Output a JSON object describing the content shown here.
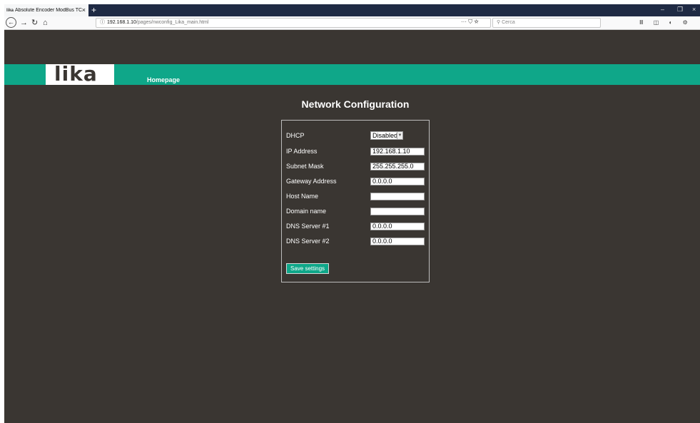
{
  "browser": {
    "tab": {
      "favicon": "lika",
      "title": "Absolute Encoder ModBus TCP",
      "close": "×"
    },
    "new_tab": "+",
    "window_controls": {
      "minimize": "–",
      "restore": "❐",
      "close": "×"
    },
    "url": {
      "host": "192.168.1.10",
      "path": "/pages/nwconfig_Lika_main.html"
    },
    "url_actions": "··· ⛉ ☆",
    "search_placeholder": "Cerca",
    "toolbar_icons": "Ⅲ ◫ ◐ ⚙ ≡"
  },
  "header": {
    "logo": "lika",
    "home_link": "Homepage"
  },
  "page_title": "Network Configuration",
  "form": {
    "dhcp": {
      "label": "DHCP",
      "value": "Disabled"
    },
    "ip_address": {
      "label": "IP Address",
      "value": "192.168.1.10"
    },
    "subnet_mask": {
      "label": "Subnet Mask",
      "value": "255.255.255.0"
    },
    "gateway": {
      "label": "Gateway Address",
      "value": "0.0.0.0"
    },
    "host_name": {
      "label": "Host Name",
      "value": ""
    },
    "domain_name": {
      "label": "Domain name",
      "value": ""
    },
    "dns1": {
      "label": "DNS Server #1",
      "value": "0.0.0.0"
    },
    "dns2": {
      "label": "DNS Server #2",
      "value": "0.0.0.0"
    },
    "save_label": "Save settings"
  },
  "colors": {
    "accent": "#0fa789",
    "background": "#3a3632"
  }
}
